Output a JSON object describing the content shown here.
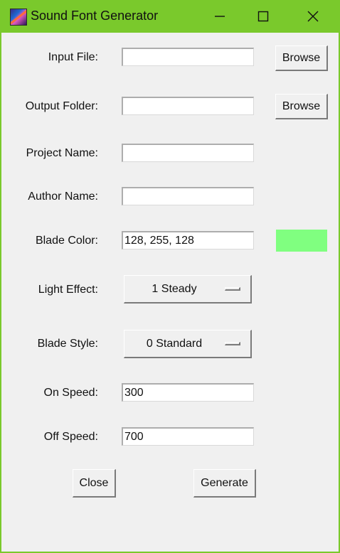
{
  "window": {
    "title": "Sound Font Generator",
    "icon": "app-saber-icon",
    "titlebar_color": "#7ac92c",
    "controls": [
      "minimize-icon",
      "maximize-icon",
      "close-icon"
    ]
  },
  "form": {
    "input_file": {
      "label": "Input File:",
      "value": "",
      "browse_label": "Browse"
    },
    "output_folder": {
      "label": "Output Folder:",
      "value": "",
      "browse_label": "Browse"
    },
    "project_name": {
      "label": "Project Name:",
      "value": ""
    },
    "author_name": {
      "label": "Author Name:",
      "value": ""
    },
    "blade_color": {
      "label": "Blade Color:",
      "value": "128, 255, 128",
      "swatch_color": "#80ff80"
    },
    "light_effect": {
      "label": "Light Effect:",
      "selected": "1 Steady"
    },
    "blade_style": {
      "label": "Blade Style:",
      "selected": "0 Standard"
    },
    "on_speed": {
      "label": "On Speed:",
      "value": "300"
    },
    "off_speed": {
      "label": "Off Speed:",
      "value": "700"
    }
  },
  "actions": {
    "close_label": "Close",
    "generate_label": "Generate"
  }
}
